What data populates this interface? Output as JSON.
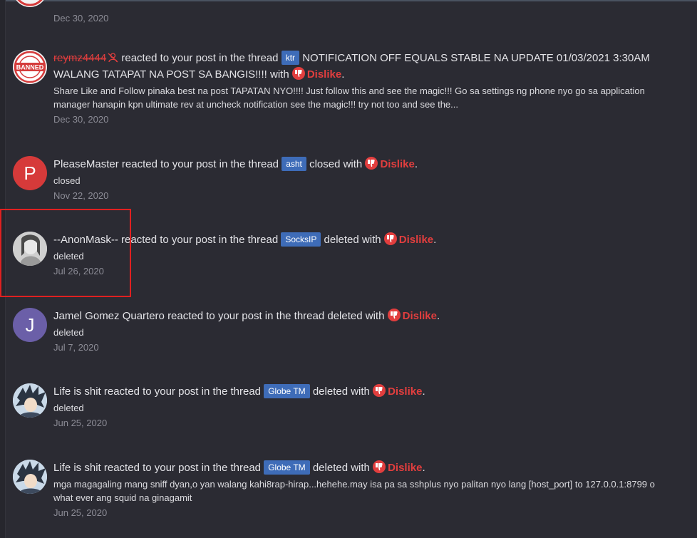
{
  "notifications": [
    {
      "date": "Dec 30, 2020"
    },
    {
      "user": "reymz4444",
      "action": "reacted to your post in the thread",
      "tag": "ktr",
      "thread_title": "NOTIFICATION OFF EQUALS STABLE NA UPDATE 01/03/2021 3:30AM WALANG TATAPAT NA POST SA BANGIS!!!!",
      "with": "with",
      "reaction": "Dislike",
      "snippet": "Share Like and Follow pinaka best na post TAPATAN NYO!!!! Just follow this and see the magic!!! Go sa settings ng phone nyo go sa application manager hanapin kpn ultimate rev at uncheck notification see the magic!!! try not too and see the...",
      "date": "Dec 30, 2020",
      "avatar_badge": "BANNED"
    },
    {
      "user": "PleaseMaster",
      "avatar_letter": "P",
      "action": "reacted to your post in the thread",
      "tag": "asht",
      "thread_title": "closed",
      "with": "with",
      "reaction": "Dislike",
      "snippet": "closed",
      "date": "Nov 22, 2020"
    },
    {
      "user": "--AnonMask--",
      "action": "reacted to your post in the thread",
      "tag": "SocksIP",
      "thread_title": "deleted",
      "with": "with",
      "reaction": "Dislike",
      "snippet": "deleted",
      "date": "Jul 26, 2020"
    },
    {
      "user": "Jamel Gomez Quartero",
      "avatar_letter": "J",
      "action": "reacted to your post in the thread",
      "thread_title": "deleted",
      "with": "with",
      "reaction": "Dislike",
      "snippet": "deleted",
      "date": "Jul 7, 2020"
    },
    {
      "user": "Life is shit",
      "action": "reacted to your post in the thread",
      "tag": "Globe TM",
      "thread_title": "deleted",
      "with": "with",
      "reaction": "Dislike",
      "snippet": "deleted",
      "date": "Jun 25, 2020"
    },
    {
      "user": "Life is shit",
      "action": "reacted to your post in the thread",
      "tag": "Globe TM",
      "thread_title": "deleted",
      "with": "with",
      "reaction": "Dislike",
      "snippet": "mga magagaling mang sniff dyan,o yan walang kahi8rap-hirap...hehehe.may isa pa sa sshplus nyo palitan nyo lang [host_port] to 127.0.0.1:8799 o what ever ang squid na ginagamit",
      "date": "Jun 25, 2020"
    }
  ],
  "colors": {
    "background": "#2b2b33",
    "dislike": "#e23e3e",
    "tag": "#3e6cb8",
    "highlight_box": "#e02020"
  }
}
